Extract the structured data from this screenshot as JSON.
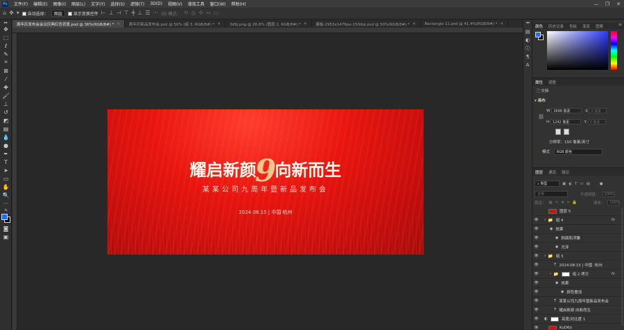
{
  "menu": {
    "app_icon": "Ps",
    "items": [
      "文件(F)",
      "编辑(E)",
      "图像(I)",
      "图层(L)",
      "文字(Y)",
      "选择(S)",
      "滤镜(T)",
      "3D(D)",
      "视图(V)",
      "增效工具",
      "窗口(W)",
      "帮助(H)"
    ]
  },
  "window_controls": [
    "—",
    "❐",
    "✕"
  ],
  "options_bar": {
    "auto_select_label": "自动选择：",
    "auto_select_value": "图层",
    "transform_label": "显示变换控件",
    "mode_3d_label": "3D 模式："
  },
  "tabs": [
    {
      "label": "周年庆发布会会议庆典红色背景.psd @ 36%(RGB/8#) *",
      "active": true
    },
    {
      "label": "周年庆新品发布会.psd @ 50% (组 3, RGB/8#) *",
      "active": false
    },
    {
      "label": "3d9j.png @ 26.8% (图层 2, RGB/8#) *",
      "active": false
    },
    {
      "label": "展板-2953x1476px-150dpi.psd @ 50%(RGB/8#) *",
      "active": false
    },
    {
      "label": "Rectangle 11.psd @ 41.4%(RGB/8#) *",
      "active": false
    }
  ],
  "canvas": {
    "title_left": "耀启新颜",
    "title_nine": "9",
    "title_right": "向新而生",
    "subtitle": "某某公司九周年暨新品发布会",
    "date": "2024.08.15 | 中国·杭州"
  },
  "color_panel": {
    "tabs": [
      "颜色",
      "历史记录",
      "色板",
      "渐变",
      "图案"
    ]
  },
  "properties_panel": {
    "tabs": [
      "属性",
      "调整"
    ],
    "doc_label": "文档",
    "canvas_label": "画布",
    "w_label": "W",
    "w_value": "2688 像素",
    "h_label": "H",
    "h_value": "1242 像素",
    "x_label": "X",
    "x_placeholder": "0 像素",
    "y_label": "Y",
    "y_placeholder": "0 像素",
    "resolution": "分辨率：150 像素/英寸",
    "mode_label": "模式",
    "mode_value": "RGB 颜色"
  },
  "layers_panel": {
    "tabs": [
      "图层",
      "通道",
      "路径"
    ],
    "filter_value": "类型",
    "blend_value": "正常",
    "opacity_label": "不透明度：",
    "opacity_value": "100%",
    "lock_label": "锁定：",
    "fill_label": "填充：",
    "fill_value": "100%",
    "layers": [
      {
        "name": "图层 5",
        "eye": false,
        "indent": 0,
        "fx": false,
        "kind": "thumb-red"
      },
      {
        "name": "组 4",
        "eye": true,
        "indent": 0,
        "fx": true,
        "kind": "group"
      },
      {
        "name": "效果",
        "eye": true,
        "indent": 1,
        "fx": false,
        "kind": "effect"
      },
      {
        "name": "斜面和浮雕",
        "eye": true,
        "indent": 2,
        "fx": false,
        "kind": "effect"
      },
      {
        "name": "光泽",
        "eye": true,
        "indent": 2,
        "fx": false,
        "kind": "effect"
      },
      {
        "name": "组 3",
        "eye": true,
        "indent": 0,
        "fx": false,
        "kind": "group"
      },
      {
        "name": "2024·08·15 | 中国 ·杭州",
        "eye": true,
        "indent": 1,
        "fx": false,
        "kind": "text"
      },
      {
        "name": "组 2 拷贝",
        "eye": true,
        "indent": 1,
        "fx": true,
        "kind": "group-thumb"
      },
      {
        "name": "效果",
        "eye": true,
        "indent": 2,
        "fx": false,
        "kind": "effect"
      },
      {
        "name": "颜色叠加",
        "eye": true,
        "indent": 3,
        "fx": false,
        "kind": "effect"
      },
      {
        "name": "某某公司九周年暨新品发布会",
        "eye": true,
        "indent": 1,
        "fx": false,
        "kind": "text"
      },
      {
        "name": "耀启新颜      向新而生",
        "eye": true,
        "indent": 1,
        "fx": false,
        "kind": "text"
      },
      {
        "name": "亮度/对比度 1",
        "eye": true,
        "indent": 0,
        "fx": false,
        "kind": "adjust"
      },
      {
        "name": "KuD6o",
        "eye": true,
        "indent": 0,
        "fx": false,
        "kind": "thumb-red"
      },
      {
        "name": "背景",
        "eye": true,
        "indent": 0,
        "fx": false,
        "kind": "thumb-black"
      }
    ],
    "fx_symbol": "fx"
  }
}
